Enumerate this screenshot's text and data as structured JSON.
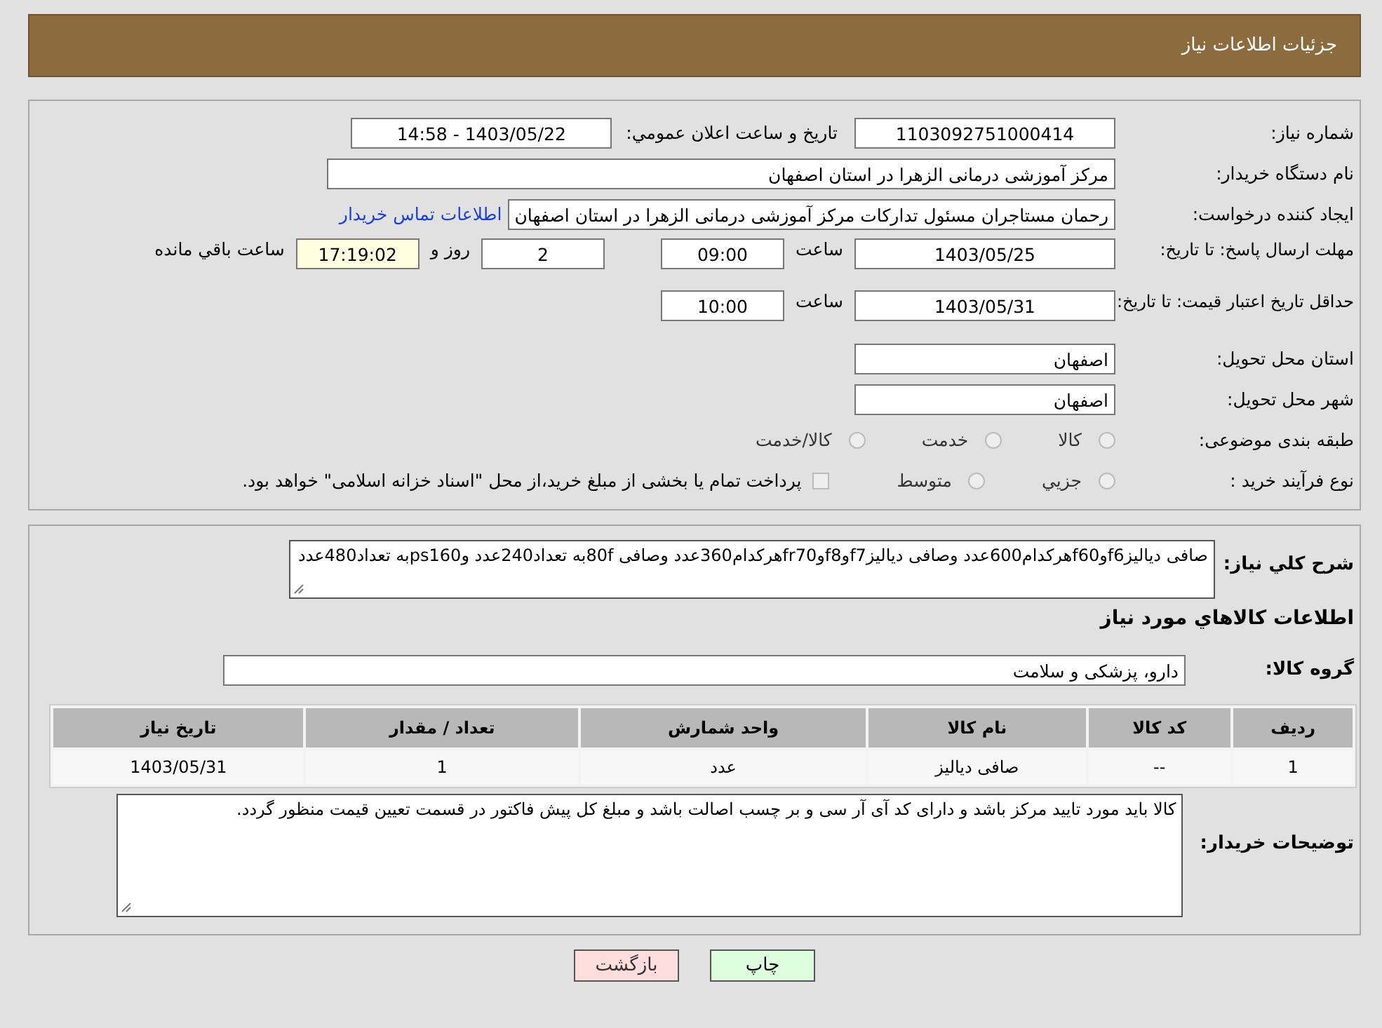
{
  "header": {
    "title": "جزئیات اطلاعات نیاز"
  },
  "need_number": {
    "label": "شماره نیاز:",
    "value": "1103092751000414"
  },
  "announce": {
    "label": "تاریخ و ساعت اعلان عمومي:",
    "value": "1403/05/22 - 14:58"
  },
  "buyer_org": {
    "label": "نام دستگاه خریدار:",
    "value": "مرکز آموزشی درمانی الزهرا در استان اصفهان"
  },
  "requester": {
    "label": "ایجاد کننده درخواست:",
    "value": "رحمان مستاجران مسئول تدارکات مرکز آموزشی درمانی الزهرا در استان اصفهان",
    "link": "اطلاعات تماس خریدار"
  },
  "reply_deadline": {
    "label": "مهلت ارسال پاسخ: تا تاریخ:",
    "date": "1403/05/25",
    "time_label": "ساعت",
    "time": "09:00",
    "days": "2",
    "days_label": "روز و",
    "remaining": "17:19:02",
    "remaining_label": "ساعت باقي مانده"
  },
  "price_validity": {
    "label": "حداقل تاریخ اعتبار قیمت: تا تاریخ:",
    "date": "1403/05/31",
    "time_label": "ساعت",
    "time": "10:00"
  },
  "province": {
    "label": "استان محل تحویل:",
    "value": "اصفهان"
  },
  "city": {
    "label": "شهر محل تحویل:",
    "value": "اصفهان"
  },
  "category": {
    "label": "طبقه بندی موضوعی:",
    "options": [
      {
        "label": "کالا",
        "selected": false
      },
      {
        "label": "خدمت",
        "selected": false
      },
      {
        "label": "کالا/خدمت",
        "selected": false
      }
    ]
  },
  "purchase_type": {
    "label": "نوع فرآیند خرید :",
    "options": [
      {
        "label": "جزیي",
        "selected": false
      },
      {
        "label": "متوسط",
        "selected": false
      }
    ],
    "note": {
      "text": "پرداخت تمام یا بخشی از مبلغ خرید،از محل \"اسناد خزانه اسلامی\" خواهد بود.",
      "checked": false
    }
  },
  "description": {
    "label": "شرح کلي نیاز:",
    "value": "صافی دیالیزf6وf60هرکدام600عدد وصافی دیالیزf7وf8وfr70هرکدام360عدد وصافی 80fبه تعداد240عدد وps160به تعداد480عدد"
  },
  "goods_title": "اطلاعات کالاهاي مورد نیاز",
  "goods_group": {
    "label": "گروه کالا:",
    "value": "دارو، پزشکی و سلامت"
  },
  "table": {
    "columns": [
      "ردیف",
      "کد کالا",
      "نام کالا",
      "واحد شمارش",
      "تعداد / مقدار",
      "تاریخ نیاز"
    ],
    "rows": [
      [
        "1",
        "--",
        "صافی دیالیز",
        "عدد",
        "1",
        "1403/05/31"
      ]
    ]
  },
  "buyer_notes": {
    "label": "توضیحات خریدار:",
    "value": "کالا باید مورد تایید مرکز باشد و دارای کد آی آر سی و بر چسب اصالت باشد و مبلغ کل پیش فاکتور در قسمت تعیین قیمت منظور گردد."
  },
  "buttons": [
    {
      "label": "چاپ",
      "kind": "print"
    },
    {
      "label": "بازگشت",
      "kind": "back"
    }
  ]
}
